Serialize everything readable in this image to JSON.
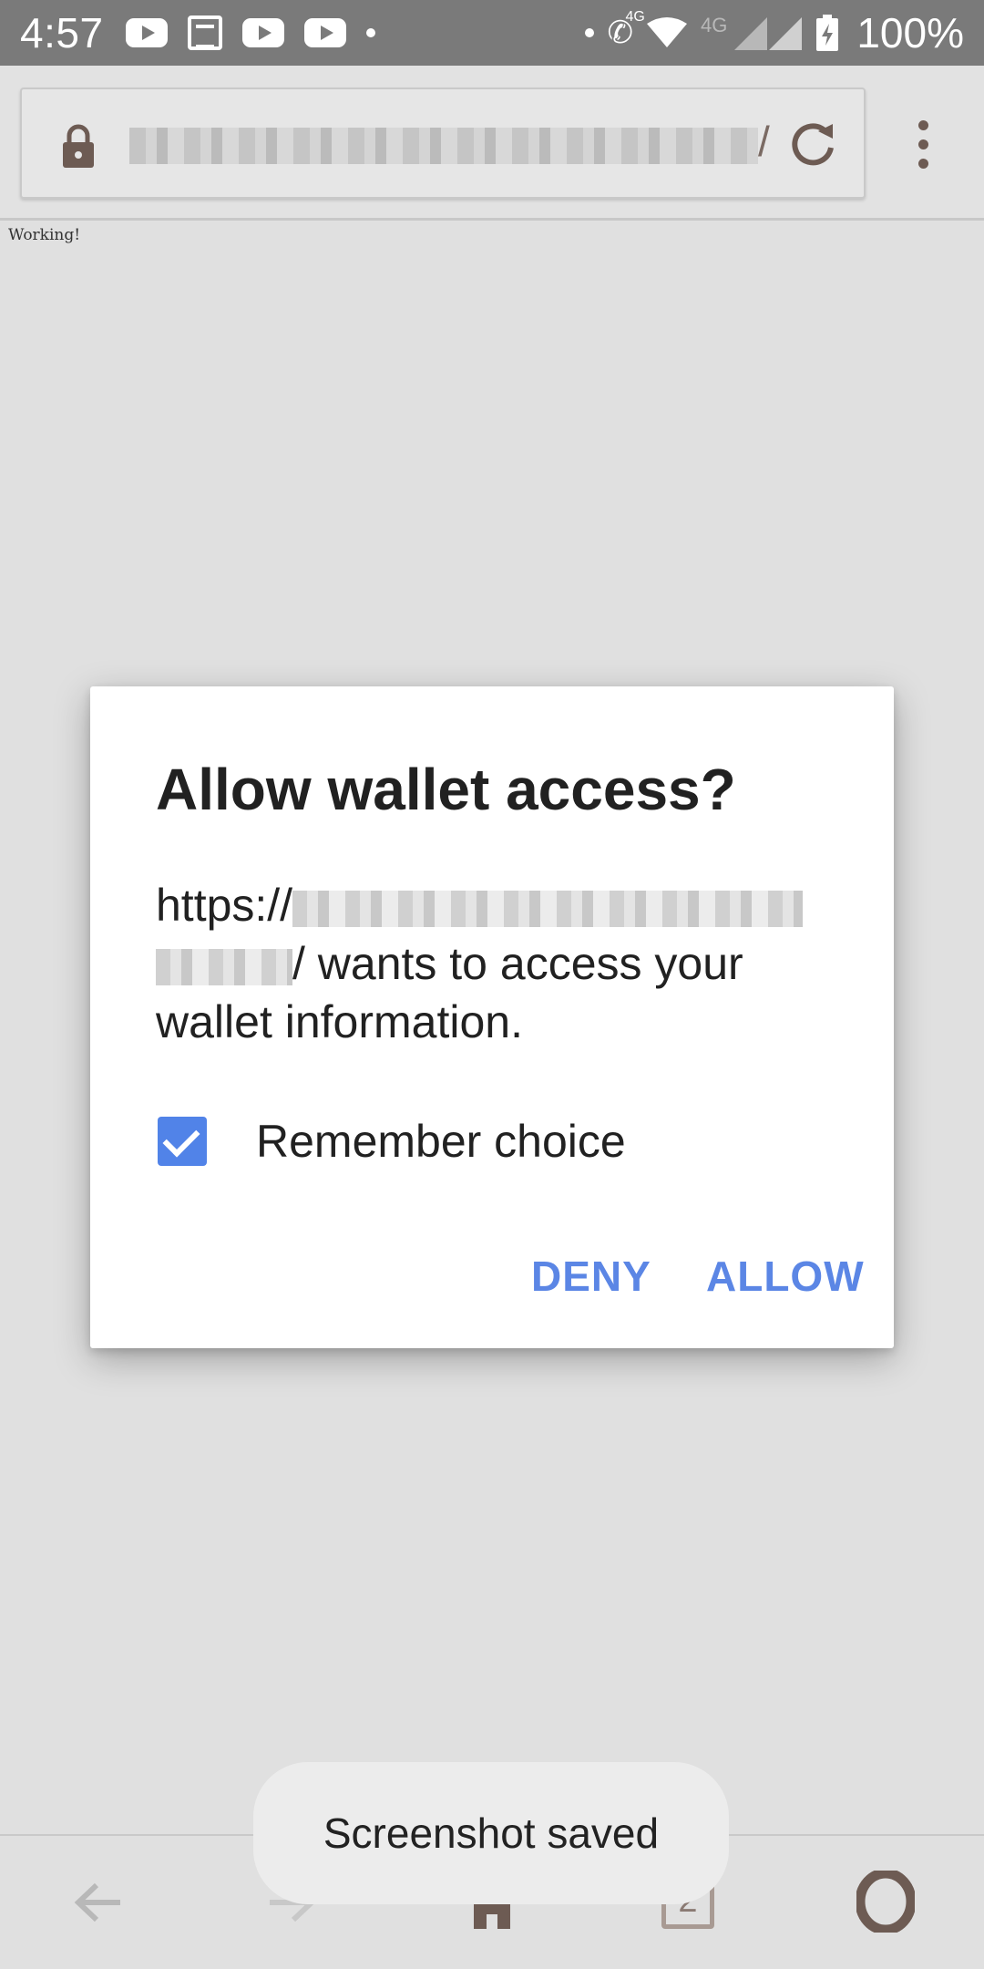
{
  "status_bar": {
    "time": "4:57",
    "network_label": "4G",
    "network_label_dim": "4G",
    "battery": "100%"
  },
  "browser": {
    "url_tail": "/",
    "page_text": "Working!"
  },
  "dialog": {
    "title": "Allow wallet access?",
    "message_prefix": "https://",
    "message_suffix": "/ wants to access your wallet information.",
    "checkbox_label": "Remember choice",
    "checkbox_checked": true,
    "deny_label": "DENY",
    "allow_label": "ALLOW",
    "accent_color": "#5b86e5"
  },
  "bottom_nav": {
    "tabs_count": "2"
  },
  "toast": {
    "text": "Screenshot saved"
  }
}
